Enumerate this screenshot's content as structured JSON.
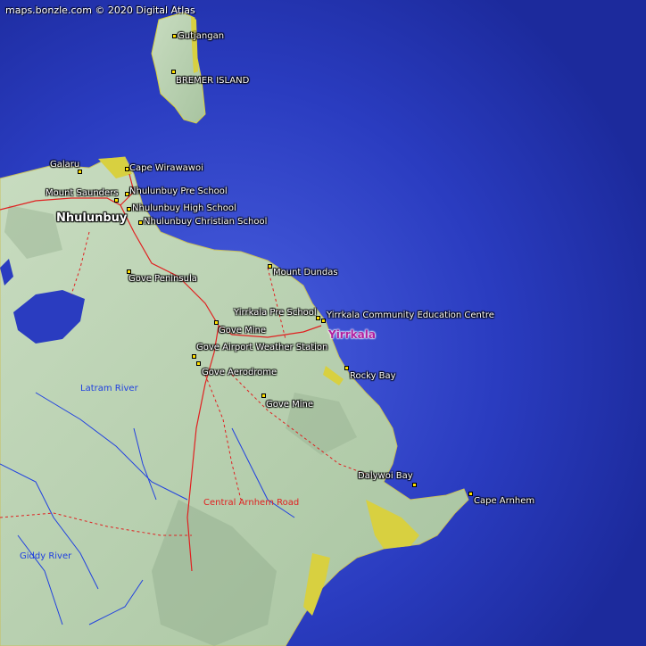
{
  "credit": "maps.bonzle.com © 2020 Digital Atlas",
  "colors": {
    "sea": "#2030b0",
    "land": "#b8d0b0",
    "beach": "#d8d040",
    "road": "#e02020",
    "river": "#2040e0",
    "town": "#b020a0"
  },
  "places": {
    "gutjangan": "Gutjangan",
    "bremer_island": "BREMER ISLAND",
    "galaru": "Galaru",
    "cape_wirawawoi": "Cape Wirawawoi",
    "mount_saunders": "Mount Saunders",
    "nhulunbuy_pre_school": "Nhulunbuy Pre School",
    "nhulunbuy": "Nhulunbuy",
    "nhulunbuy_high_school": "Nhulunbuy High School",
    "nhulunbuy_christian_school": "Nhulunbuy Christian School",
    "mount_dundas": "Mount Dundas",
    "gove_peninsula": "Gove Peninsula",
    "yirrkala_pre_school": "Yirrkala Pre School",
    "yirrkala_ced": "Yirrkala Community Education Centre",
    "gove_mine_1": "Gove Mine",
    "yirrkala": "Yirrkala",
    "gove_airport_ws": "Gove Airport Weather Station",
    "rocky_bay": "Rocky Bay",
    "gove_aerodrome": "Gove Aerodrome",
    "latram_river": "Latram River",
    "gove_mine_2": "Gove Mine",
    "dalywoi_bay": "Dalywoi Bay",
    "cape_arnhem": "Cape Arnhem",
    "central_arnhem_road": "Central Arnhem Road",
    "giddy_river": "Giddy River"
  }
}
